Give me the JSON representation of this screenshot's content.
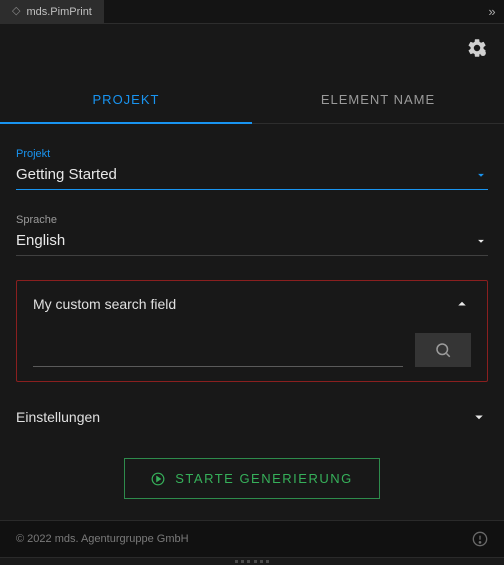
{
  "window": {
    "tab_title": "mds.PimPrint"
  },
  "tabs": {
    "project": "PROJEKT",
    "element_name": "ELEMENT NAME",
    "active": "project"
  },
  "fields": {
    "project": {
      "label": "Projekt",
      "value": "Getting Started"
    },
    "language": {
      "label": "Sprache",
      "value": "English"
    }
  },
  "search": {
    "title": "My custom search field",
    "value": "",
    "placeholder": ""
  },
  "settings": {
    "title": "Einstellungen"
  },
  "actions": {
    "generate": "STARTE GENERIERUNG"
  },
  "footer": {
    "copyright": "© 2022 mds. Agenturgruppe GmbH"
  }
}
